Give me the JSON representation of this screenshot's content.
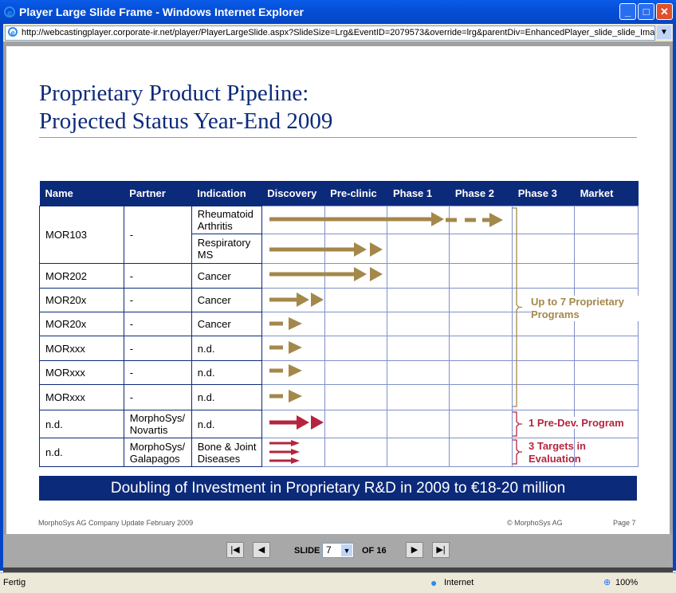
{
  "window": {
    "title": "Player Large Slide Frame - Windows Internet Explorer",
    "url": "http://webcastingplayer.corporate-ir.net/player/PlayerLargeSlide.aspx?SlideSize=Lrg&EventID=2079573&override=lrg&parentDiv=EnhancedPlayer_slide_slide_Imag"
  },
  "slide": {
    "title1": "Proprietary Product Pipeline:",
    "title2": "Projected Status Year-End 2009",
    "headers": [
      "Name",
      "Partner",
      "Indication",
      "Discovery",
      "Pre-clinic",
      "Phase 1",
      "Phase 2",
      "Phase 3",
      "Market"
    ],
    "rows": [
      {
        "name": "MOR103",
        "partner": "-",
        "indication": "Rheumatoid Arthritis"
      },
      {
        "indication": "Respiratory MS"
      },
      {
        "name": "MOR202",
        "partner": "-",
        "indication": "Cancer"
      },
      {
        "name": "MOR20x",
        "partner": "-",
        "indication": "Cancer"
      },
      {
        "name": "MOR20x",
        "partner": "-",
        "indication": "Cancer"
      },
      {
        "name": "MORxxx",
        "partner": "-",
        "indication": "n.d."
      },
      {
        "name": "MORxxx",
        "partner": "-",
        "indication": "n.d."
      },
      {
        "name": "MORxxx",
        "partner": "-",
        "indication": "n.d."
      },
      {
        "name": "n.d.",
        "partner": "MorphoSys/ Novartis",
        "indication": "n.d."
      },
      {
        "name": "n.d.",
        "partner": "MorphoSys/ Galapagos",
        "indication": "Bone & Joint Diseases"
      }
    ],
    "annotations": {
      "proprietary": "Up to 7 Proprietary Programs",
      "predev": "1 Pre-Dev. Program",
      "targets": "3 Targets in Evaluation"
    },
    "colors": {
      "proprietary": "#a4884a",
      "partnered": "#b5253f",
      "navy": "#0c2a7a"
    },
    "banner": "Doubling of Investment in Proprietary R&D in 2009 to €18-20 million",
    "footer_left": "MorphoSys AG  Company Update  February 2009",
    "footer_mid": "© MorphoSys AG",
    "footer_right": "Page 7"
  },
  "nav": {
    "slide_label": "SLIDE",
    "slide_value": "7",
    "of_label": "OF 16"
  },
  "status": {
    "left": "Fertig",
    "zone": "Internet",
    "zoom": "100%"
  }
}
